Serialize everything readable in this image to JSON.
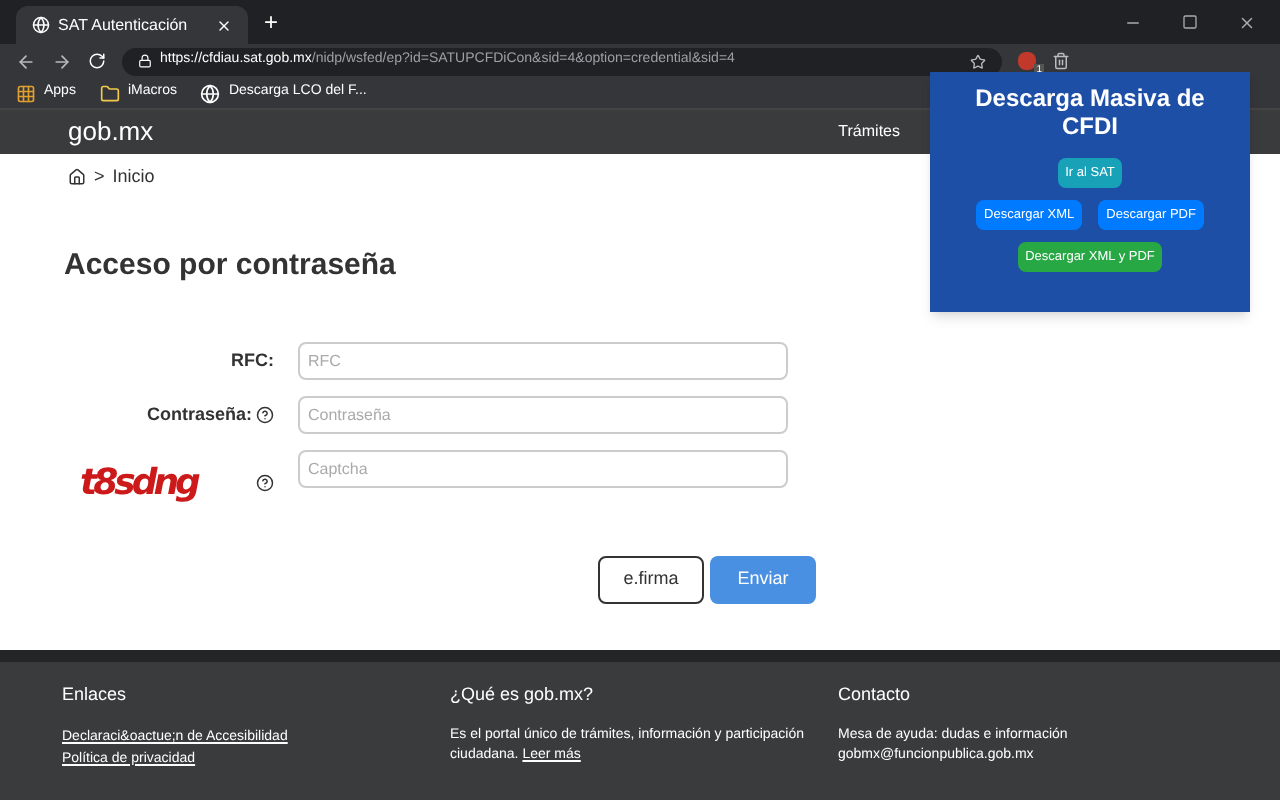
{
  "browser": {
    "tabs": [
      {
        "title": "SAT Autenticación",
        "selected": true
      }
    ],
    "new_tab": "+",
    "url_host": "https://cfdiau.sat.gob.mx",
    "url_path": "/nidp/wsfed/ep?id=SATUPCFDiCon&sid=4&option=credential&sid=4",
    "extension_badge": "1",
    "bookmarks": [
      {
        "label": "Apps",
        "kind": "apps"
      },
      {
        "label": "iMacros",
        "kind": "folder"
      },
      {
        "label": "Descarga LCO del F...",
        "kind": "site"
      }
    ]
  },
  "header": {
    "logo": "gob.mx",
    "nav": [
      "Trámites"
    ]
  },
  "breadcrumb": {
    "separator": ">",
    "current": "Inicio"
  },
  "form": {
    "title": "Acceso por contraseña",
    "fields": [
      {
        "label": "RFC:",
        "placeholder": "RFC",
        "help": false
      },
      {
        "label": "Contraseña:",
        "placeholder": "Contraseña",
        "help": true
      }
    ],
    "captcha": {
      "text": "t8sdng",
      "placeholder": "Captcha"
    },
    "buttons": [
      {
        "label": "e.firma",
        "kind": "secondary"
      },
      {
        "label": "Enviar",
        "kind": "primary"
      }
    ]
  },
  "footer": {
    "columns": [
      {
        "title": "Enlaces",
        "lines": [
          {
            "text": "Declaraci&oactue;n de Accesibilidad",
            "link": true
          },
          {
            "text": "Política de privacidad",
            "link": true
          }
        ]
      },
      {
        "title": "¿Qué es gob.mx?",
        "lines": [
          {
            "text": "Es el portal único de trámites, información y participación ciudadana.",
            "link": false,
            "link_text": "Leer más"
          }
        ]
      },
      {
        "title": "Contacto",
        "lines": [
          {
            "text": "Mesa de ayuda: dudas e información",
            "link": false
          },
          {
            "text": "gobmx@funcionpublica.gob.mx",
            "link": false
          }
        ]
      }
    ]
  },
  "popup": {
    "title": "Descarga Masiva de CFDI",
    "buttons": [
      {
        "label": "Ir al SAT",
        "color": "#17a2b8"
      },
      {
        "label": "Descargar XML",
        "color": "#007bff"
      },
      {
        "label": "Descargar PDF",
        "color": "#007bff"
      },
      {
        "label": "Descargar XML y PDF",
        "color": "#28a745"
      }
    ]
  }
}
